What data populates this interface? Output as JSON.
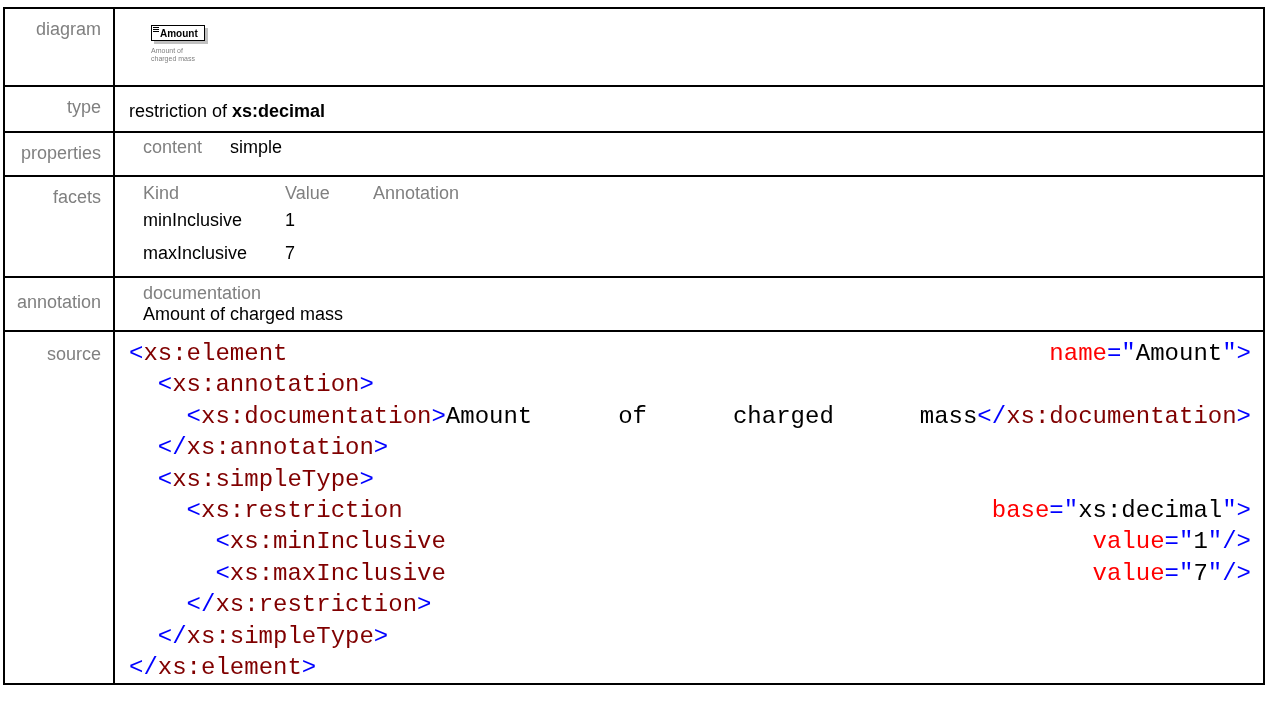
{
  "rows": [
    {
      "kind": "diagram",
      "label": "diagram",
      "element_name": "Amount",
      "element_doc": "Amount of charged mass"
    },
    {
      "kind": "type",
      "label": "type",
      "text": "restriction of **xs:decimal**"
    },
    {
      "kind": "properties",
      "label": "properties",
      "items": [
        {
          "name": "content",
          "value": "simple"
        }
      ]
    },
    {
      "kind": "facets",
      "label": "facets",
      "columns": [
        "Kind",
        "Value",
        "Annotation"
      ],
      "facets": [
        {
          "kind": "minInclusive",
          "value": "1"
        },
        {
          "kind": "maxInclusive",
          "value": "7"
        }
      ]
    },
    {
      "kind": "annotation",
      "label": "annotation",
      "heading": "documentation",
      "text": "Amount of charged mass"
    },
    {
      "kind": "source",
      "label": "source",
      "lines": [
        {
          "words": [
            [
              {
                "kind": "punct",
                "s": "<"
              },
              {
                "kind": "tag",
                "s": "xs:element"
              }
            ],
            [
              {
                "kind": "attr",
                "s": "name"
              },
              {
                "kind": "punct",
                "s": "=\""
              },
              {
                "kind": "value",
                "s": "Amount"
              },
              {
                "kind": "punct",
                "s": "\">"
              }
            ]
          ]
        },
        {
          "words": [
            [
              {
                "kind": "punct",
                "s": "  <"
              },
              {
                "kind": "tag",
                "s": "xs:annotation"
              },
              {
                "kind": "punct",
                "s": ">"
              }
            ]
          ]
        },
        {
          "words": [
            [
              {
                "kind": "punct",
                "s": "    <"
              },
              {
                "kind": "tag",
                "s": "xs:documentation"
              },
              {
                "kind": "punct",
                "s": ">"
              },
              {
                "kind": "text",
                "s": "Amount"
              }
            ],
            [
              {
                "kind": "text",
                "s": "of"
              }
            ],
            [
              {
                "kind": "text",
                "s": "charged"
              }
            ],
            [
              {
                "kind": "text",
                "s": "mass"
              },
              {
                "kind": "punct",
                "s": "</"
              },
              {
                "kind": "tag",
                "s": "xs:documentation"
              },
              {
                "kind": "punct",
                "s": ">"
              }
            ]
          ]
        },
        {
          "words": [
            [
              {
                "kind": "punct",
                "s": "  </"
              },
              {
                "kind": "tag",
                "s": "xs:annotation"
              },
              {
                "kind": "punct",
                "s": ">"
              }
            ]
          ]
        },
        {
          "words": [
            [
              {
                "kind": "punct",
                "s": "  <"
              },
              {
                "kind": "tag",
                "s": "xs:simpleType"
              },
              {
                "kind": "punct",
                "s": ">"
              }
            ]
          ]
        },
        {
          "words": [
            [
              {
                "kind": "punct",
                "s": "    <"
              },
              {
                "kind": "tag",
                "s": "xs:restriction"
              }
            ],
            [
              {
                "kind": "attr",
                "s": "base"
              },
              {
                "kind": "punct",
                "s": "=\""
              },
              {
                "kind": "value",
                "s": "xs:decimal"
              },
              {
                "kind": "punct",
                "s": "\">"
              }
            ]
          ]
        },
        {
          "words": [
            [
              {
                "kind": "punct",
                "s": "      <"
              },
              {
                "kind": "tag",
                "s": "xs:minInclusive"
              }
            ],
            [
              {
                "kind": "attr",
                "s": "value"
              },
              {
                "kind": "punct",
                "s": "=\""
              },
              {
                "kind": "value",
                "s": "1"
              },
              {
                "kind": "punct",
                "s": "\"/>"
              }
            ]
          ]
        },
        {
          "words": [
            [
              {
                "kind": "punct",
                "s": "      <"
              },
              {
                "kind": "tag",
                "s": "xs:maxInclusive"
              }
            ],
            [
              {
                "kind": "attr",
                "s": "value"
              },
              {
                "kind": "punct",
                "s": "=\""
              },
              {
                "kind": "value",
                "s": "7"
              },
              {
                "kind": "punct",
                "s": "\"/>"
              }
            ]
          ]
        },
        {
          "words": [
            [
              {
                "kind": "punct",
                "s": "    </"
              },
              {
                "kind": "tag",
                "s": "xs:restriction"
              },
              {
                "kind": "punct",
                "s": ">"
              }
            ]
          ]
        },
        {
          "words": [
            [
              {
                "kind": "punct",
                "s": "  </"
              },
              {
                "kind": "tag",
                "s": "xs:simpleType"
              },
              {
                "kind": "punct",
                "s": ">"
              }
            ]
          ]
        },
        {
          "words": [
            [
              {
                "kind": "punct",
                "s": "</"
              },
              {
                "kind": "tag",
                "s": "xs:element"
              },
              {
                "kind": "punct",
                "s": ">"
              }
            ]
          ]
        }
      ]
    }
  ]
}
